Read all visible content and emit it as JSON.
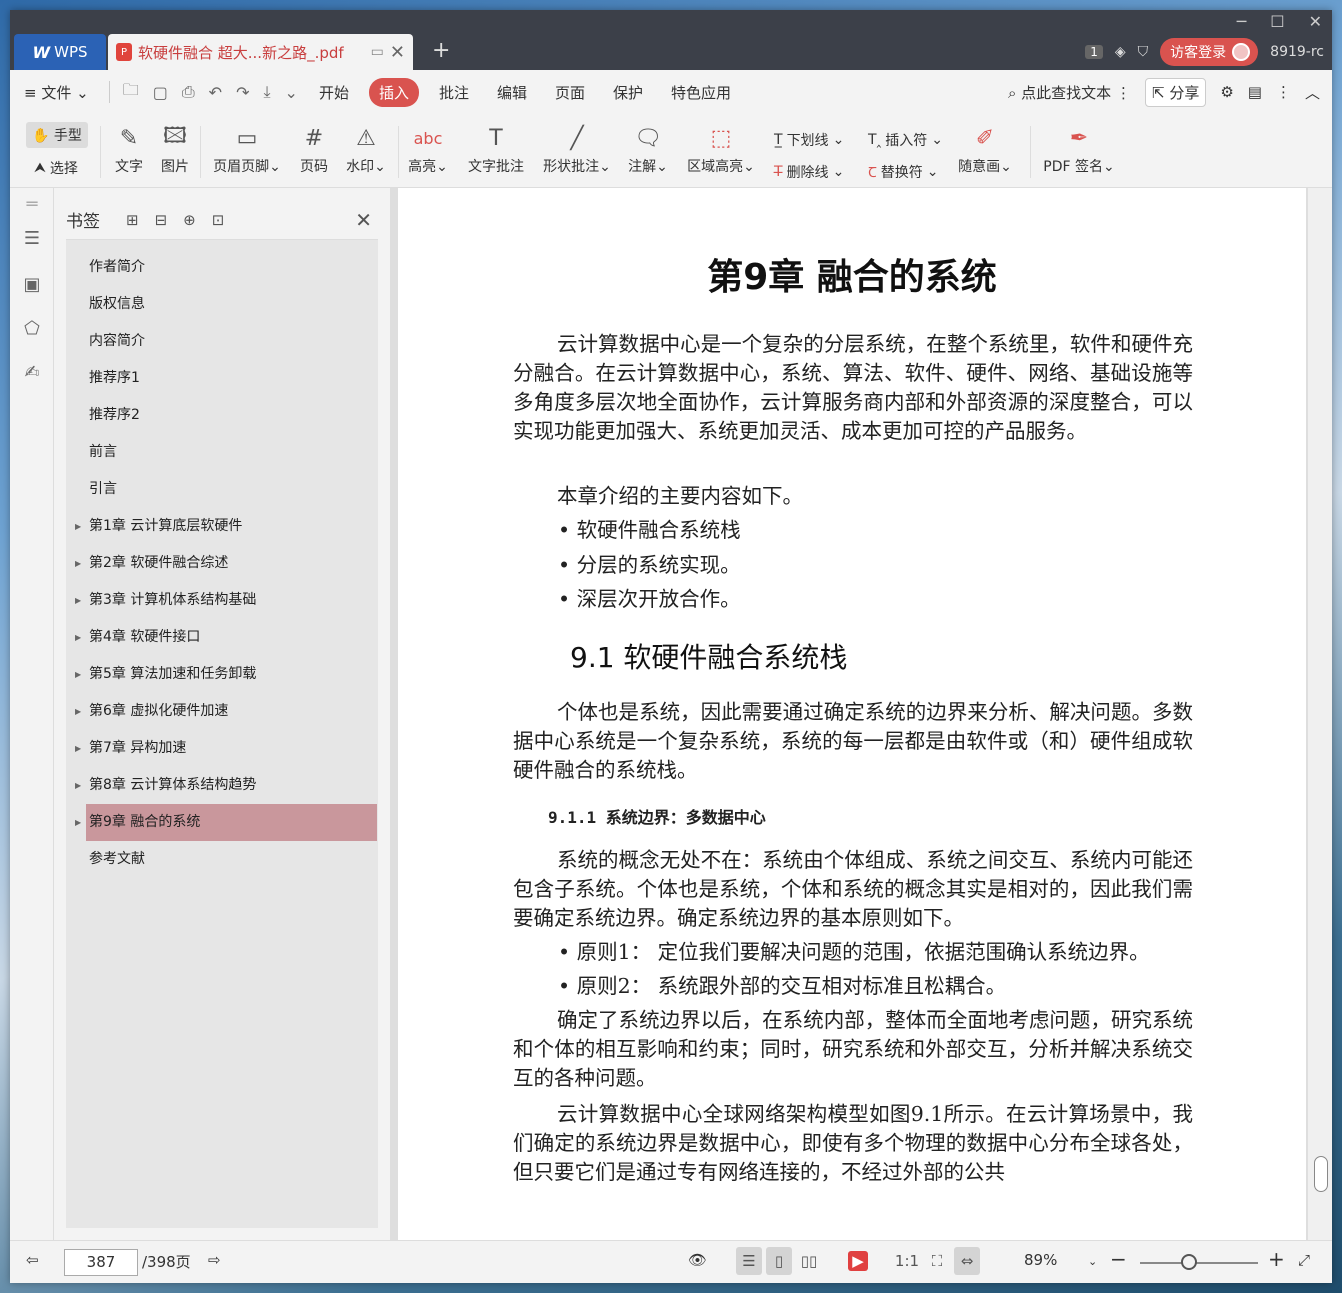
{
  "titlebar": {
    "app_tab": "WPS",
    "doc_tab": "软硬件融合 超大...新之路_.pdf",
    "count_badge": "1",
    "login": "访客登录",
    "version": "8919-rc"
  },
  "menubar": {
    "file": "文件",
    "items": [
      "开始",
      "插入",
      "批注",
      "编辑",
      "页面",
      "保护",
      "特色应用"
    ],
    "search": "点此查找文本",
    "share": "分享"
  },
  "ribbon": {
    "hand": "手型",
    "select": "选择",
    "text": "文字",
    "image": "图片",
    "header_footer": "页眉页脚",
    "page_no": "页码",
    "watermark": "水印",
    "highlight": "高亮",
    "text_note": "文字批注",
    "shape_note": "形状批注",
    "comment": "注解",
    "area_highlight": "区域高亮",
    "underline": "下划线",
    "strikethrough": "删除线",
    "insert_mark": "插入符",
    "replace_mark": "替换符",
    "freehand": "随意画",
    "pdf_sign": "PDF 签名"
  },
  "bookmarks": {
    "title": "书签",
    "items": [
      {
        "label": "作者简介",
        "expandable": false
      },
      {
        "label": "版权信息",
        "expandable": false
      },
      {
        "label": "内容简介",
        "expandable": false
      },
      {
        "label": "推荐序1",
        "expandable": false
      },
      {
        "label": "推荐序2",
        "expandable": false
      },
      {
        "label": "前言",
        "expandable": false
      },
      {
        "label": "引言",
        "expandable": false
      },
      {
        "label": "第1章 云计算底层软硬件",
        "expandable": true
      },
      {
        "label": "第2章 软硬件融合综述",
        "expandable": true
      },
      {
        "label": "第3章 计算机体系结构基础",
        "expandable": true
      },
      {
        "label": "第4章 软硬件接口",
        "expandable": true
      },
      {
        "label": "第5章 算法加速和任务卸载",
        "expandable": true
      },
      {
        "label": "第6章 虚拟化硬件加速",
        "expandable": true
      },
      {
        "label": "第7章 异构加速",
        "expandable": true
      },
      {
        "label": "第8章 云计算体系结构趋势",
        "expandable": true
      },
      {
        "label": "第9章 融合的系统",
        "expandable": true,
        "selected": true
      },
      {
        "label": "参考文献",
        "expandable": false
      }
    ]
  },
  "document": {
    "chapter_title": "第9章  融合的系统",
    "p1": "云计算数据中心是一个复杂的分层系统，在整个系统里，软件和硬件充分融合。在云计算数据中心，系统、算法、软件、硬件、网络、基础设施等多角度多层次地全面协作，云计算服务商内部和外部资源的深度整合，可以实现功能更加强大、系统更加灵活、成本更加可控的产品服务。",
    "p2": "本章介绍的主要内容如下。",
    "bullets1": [
      "• 软硬件融合系统栈",
      "• 分层的系统实现。",
      "• 深层次开放合作。"
    ],
    "section_title": "9.1  软硬件融合系统栈",
    "p3": "个体也是系统，因此需要通过确定系统的边界来分析、解决问题。多数据中心系统是一个复杂系统，系统的每一层都是由软件或（和）硬件组成软硬件融合的系统栈。",
    "subsection_title": "9.1.1  系统边界：多数据中心",
    "p4": "系统的概念无处不在：系统由个体组成、系统之间交互、系统内可能还包含子系统。个体也是系统，个体和系统的概念其实是相对的，因此我们需要确定系统边界。确定系统边界的基本原则如下。",
    "bullets2": [
      "• 原则1： 定位我们要解决问题的范围，依据范围确认系统边界。",
      "• 原则2： 系统跟外部的交互相对标准且松耦合。"
    ],
    "p5": "确定了系统边界以后，在系统内部，整体而全面地考虑问题，研究系统和个体的相互影响和约束；同时，研究系统和外部交互，分析并解决系统交互的各种问题。",
    "p6": "云计算数据中心全球网络架构模型如图9.1所示。在云计算场景中，我们确定的系统边界是数据中心，即使有多个物理的数据中心分布全球各处，但只要它们是通过专有网络连接的，不经过外部的公共"
  },
  "statusbar": {
    "current_page": "387",
    "total_pages": "/398页",
    "zoom": "89%"
  }
}
